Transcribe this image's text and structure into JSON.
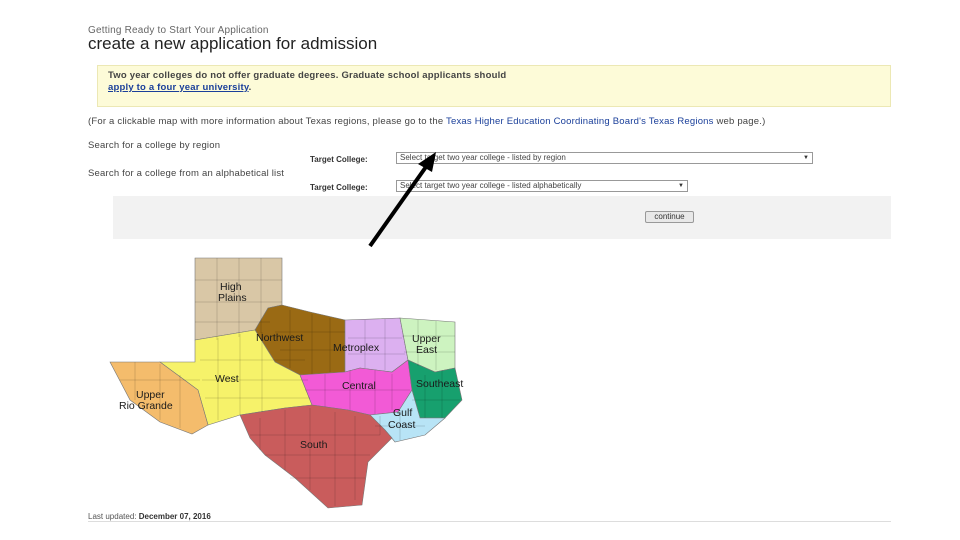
{
  "header": {
    "breadcrumb": "Getting Ready to Start Your Application",
    "title": "create a new application for admission"
  },
  "notice": {
    "text": "Two year colleges do not offer graduate degrees. Graduate school applicants should",
    "link_text": "apply to a four year university",
    "suffix": "."
  },
  "info": {
    "prefix": "(For a clickable map with more information about Texas regions, please go to the ",
    "link_text": "Texas Higher Education Coordinating Board's Texas Regions",
    "suffix": " web page.)"
  },
  "search_region": {
    "label": "Search for a college by region",
    "field_label": "Target College:",
    "select_value": "Select target two year college - listed by region"
  },
  "search_alpha": {
    "label": "Search for a college from an alphabetical list",
    "field_label": "Target College:",
    "select_value": "Select target two year college - listed alphabetically"
  },
  "actions": {
    "continue_label": "continue"
  },
  "map": {
    "regions": [
      {
        "label1": "High",
        "label2": "Plains",
        "color": "#d9c7a6"
      },
      {
        "label1": "Northwest",
        "label2": "",
        "color": "#9a6a14"
      },
      {
        "label1": "Metroplex",
        "label2": "",
        "color": "#dcb0f0"
      },
      {
        "label1": "Upper",
        "label2": "East",
        "color": "#cdf3c0"
      },
      {
        "label1": "West",
        "label2": "",
        "color": "#f6f26a"
      },
      {
        "label1": "Upper",
        "label2": "Rio Grande",
        "color": "#f4bc6c"
      },
      {
        "label1": "Central",
        "label2": "",
        "color": "#f25ad6"
      },
      {
        "label1": "Southeast",
        "label2": "",
        "color": "#17a06e"
      },
      {
        "label1": "Gulf",
        "label2": "Coast",
        "color": "#b8e4f6"
      },
      {
        "label1": "South",
        "label2": "",
        "color": "#c95c5c"
      }
    ]
  },
  "footer": {
    "label": "Last updated:",
    "date": "December 07, 2016"
  }
}
